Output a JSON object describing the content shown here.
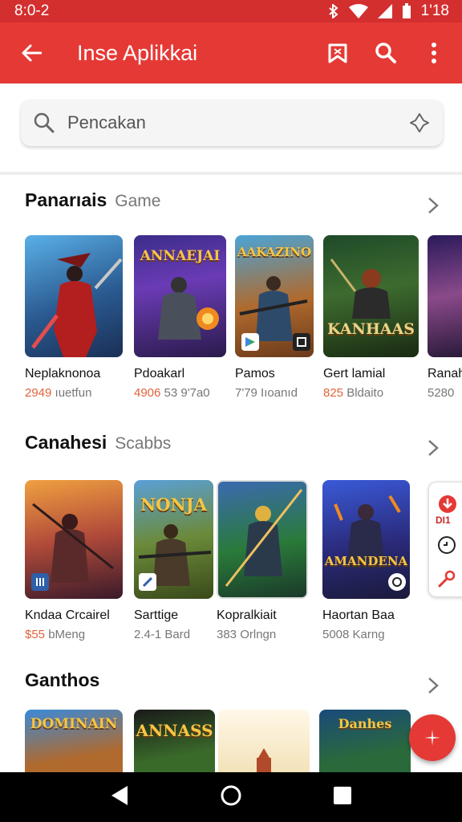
{
  "status_bar": {
    "time": "8:0-2",
    "right_text": "1'18"
  },
  "app_bar": {
    "title": "Inse Aplikkai"
  },
  "search": {
    "placeholder": "Pencakan"
  },
  "sections": [
    {
      "title": "Panarıais",
      "subtitle": "Game",
      "cards": [
        {
          "name": "Neplaknonoa",
          "meta_highlight": "2949",
          "meta_rest": " ıuetfun",
          "banner": ""
        },
        {
          "name": "Pdoakarl",
          "meta_highlight": "4906",
          "meta_rest": " 53 9'7a0",
          "banner": "ANNAEJAI"
        },
        {
          "name": "Pamos",
          "meta_highlight": "",
          "meta_rest": "7'79 Iıoanıd",
          "banner": "AAKAZINO"
        },
        {
          "name": "Gert lamial",
          "meta_highlight": "825",
          "meta_rest": " Bldaito",
          "banner": "KANHAAS"
        },
        {
          "name": "Ranah",
          "meta_highlight": "",
          "meta_rest": "5280",
          "banner": ""
        }
      ]
    },
    {
      "title": "Canahesi",
      "subtitle": "Scabbs",
      "cards": [
        {
          "name": "Kndaa Crcairel",
          "meta_highlight": "$55",
          "meta_rest": " bMeng",
          "banner": ""
        },
        {
          "name": "Sarttige",
          "meta_highlight": "",
          "meta_rest": "2.4-1 Bard",
          "banner": "NONJA"
        },
        {
          "name": "Kopralkiait",
          "meta_highlight": "",
          "meta_rest": "383 Orlngn",
          "banner": ""
        },
        {
          "name": "Haortan Baa",
          "meta_highlight": "",
          "meta_rest": "5008 Karng",
          "banner": "AMANDENA"
        }
      ]
    },
    {
      "title": "Ganthos",
      "subtitle": "",
      "cards": [
        {
          "banner": "DOMINAIN"
        },
        {
          "banner": "ANNASS"
        },
        {
          "banner": ""
        },
        {
          "banner": "Danhes"
        }
      ]
    }
  ],
  "side_panel": {
    "label": "DI1"
  },
  "colors": {
    "primary": "#e53935",
    "status": "#d32f2f",
    "accent_text": "#e2623b"
  }
}
